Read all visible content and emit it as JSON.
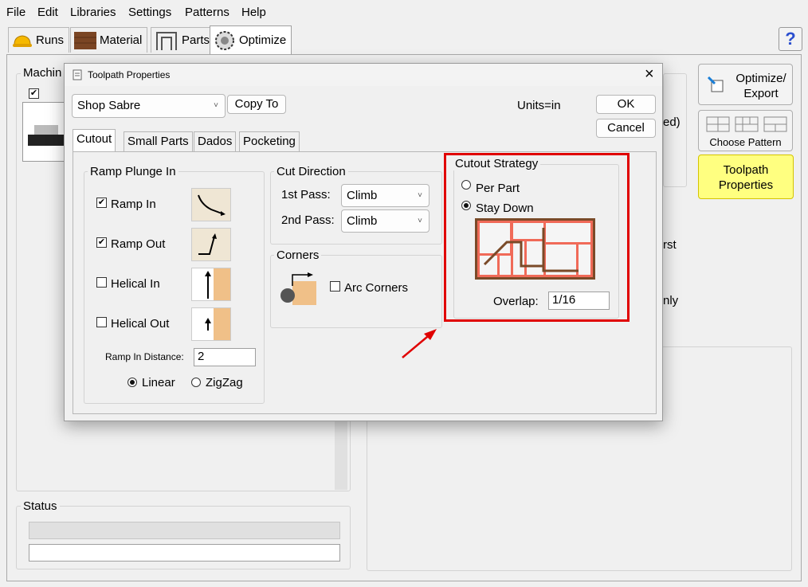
{
  "menu": [
    "File",
    "Edit",
    "Libraries",
    "Settings",
    "Patterns",
    "Help"
  ],
  "tabs": [
    {
      "label": "Runs",
      "icon": "hardhat-icon"
    },
    {
      "label": "Material",
      "icon": "wood-icon"
    },
    {
      "label": "Parts",
      "icon": "parts-icon"
    },
    {
      "label": "Optimize",
      "icon": "saw-blade-icon"
    }
  ],
  "help_glyph": "?",
  "background": {
    "machine_group_partial": "Machin",
    "status_title": "Status",
    "partial_right_1": "ed)",
    "partial_right_2": "rst",
    "partial_right_3": "nly"
  },
  "right_buttons": {
    "optimize_export": "Optimize/\nExport",
    "choose_pattern": "Choose Pattern",
    "toolpath_properties": "Toolpath\nProperties"
  },
  "dialog": {
    "title": "Toolpath Properties",
    "close": "×",
    "machine": "Shop Sabre",
    "copy_to": "Copy To",
    "units": "Units=in",
    "ok": "OK",
    "cancel": "Cancel",
    "tabs": [
      "Cutout",
      "Small Parts",
      "Dados",
      "Pocketing"
    ],
    "ramp": {
      "title": "Ramp Plunge In",
      "ramp_in": "Ramp In",
      "ramp_out": "Ramp Out",
      "helical_in": "Helical In",
      "helical_out": "Helical Out",
      "distance_label": "Ramp In Distance:",
      "distance_value": "2",
      "linear": "Linear",
      "zigzag": "ZigZag",
      "checked": {
        "ramp_in": true,
        "ramp_out": true,
        "helical_in": false,
        "helical_out": false
      },
      "mode": "Linear"
    },
    "cut_direction": {
      "title": "Cut Direction",
      "first_label": "1st Pass:",
      "first_value": "Climb",
      "second_label": "2nd Pass:",
      "second_value": "Climb"
    },
    "corners": {
      "title": "Corners",
      "arc_corners": "Arc Corners",
      "arc_checked": false
    },
    "cutout_strategy": {
      "title": "Cutout Strategy",
      "per_part": "Per Part",
      "stay_down": "Stay Down",
      "selected": "Stay Down",
      "overlap_label": "Overlap:",
      "overlap_value": "1/16",
      "highlight_color": "#e00000"
    }
  },
  "colors": {
    "toolpath_button_bg": "#ffff80",
    "annotation_red": "#e00000"
  }
}
